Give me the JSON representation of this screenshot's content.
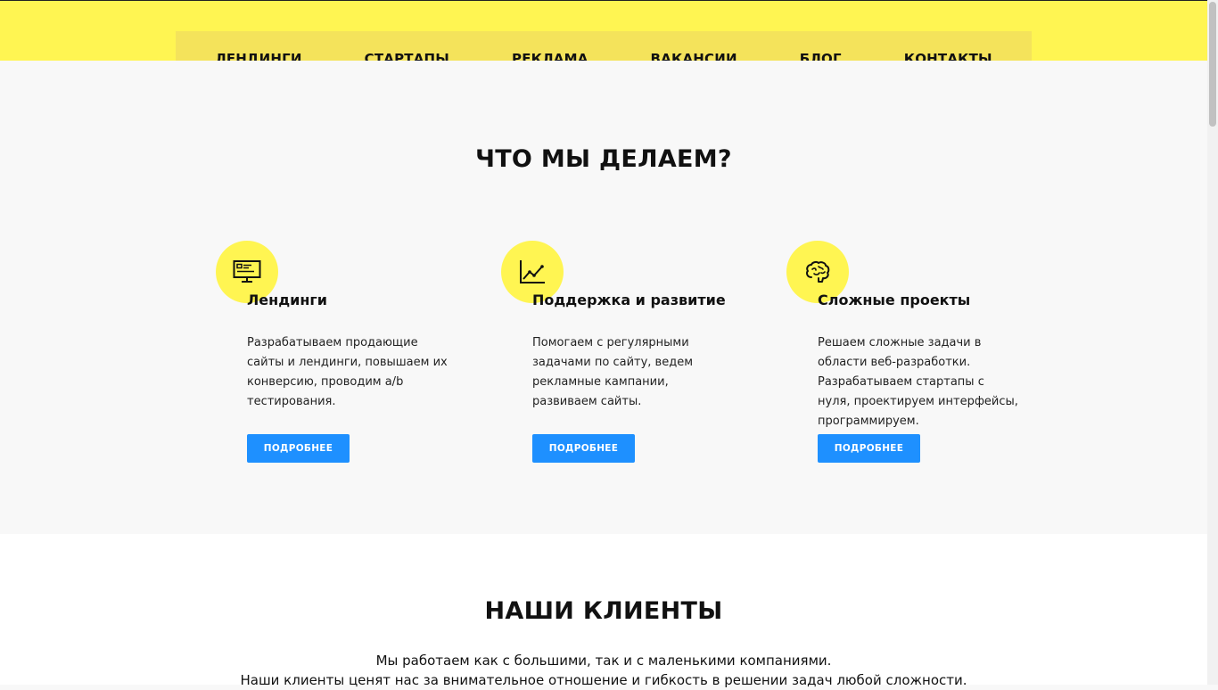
{
  "nav": {
    "items": [
      {
        "label": "ЛЕНДИНГИ"
      },
      {
        "label": "СТАРТАПЫ"
      },
      {
        "label": "РЕКЛАМА"
      },
      {
        "label": "ВАКАНСИИ"
      },
      {
        "label": "БЛОГ"
      },
      {
        "label": "КОНТАКТЫ"
      }
    ]
  },
  "services": {
    "heading": "ЧТО МЫ ДЕЛАЕМ?",
    "cards": [
      {
        "icon": "monitor-icon",
        "title": "Лендинги",
        "description": "Разрабатываем продающие сайты и лендинги, повышаем их конверсию, проводим a/b тестирования.",
        "button_label": "ПОДРОБНЕЕ"
      },
      {
        "icon": "chart-icon",
        "title": "Поддержка и развитие",
        "description": "Помогаем с регулярными задачами по сайту, ведем рекламные кампании, развиваем сайты.",
        "button_label": "ПОДРОБНЕЕ"
      },
      {
        "icon": "brain-icon",
        "title": "Сложные проекты",
        "description": "Решаем сложные задачи в области веб-разработки. Разрабатываем стартапы с нуля, проектируем интерфейсы, программируем.",
        "button_label": "ПОДРОБНЕЕ"
      }
    ]
  },
  "clients": {
    "heading": "НАШИ КЛИЕНТЫ",
    "line1": "Мы работаем как с большими, так и с маленькими компаниями.",
    "line2": "Наши клиенты ценят нас за внимательное отношение и гибкость в решении задач любой сложности."
  },
  "colors": {
    "accent_yellow": "#fff552",
    "nav_bg": "#f4e35b",
    "button_blue": "#1e90ff"
  }
}
